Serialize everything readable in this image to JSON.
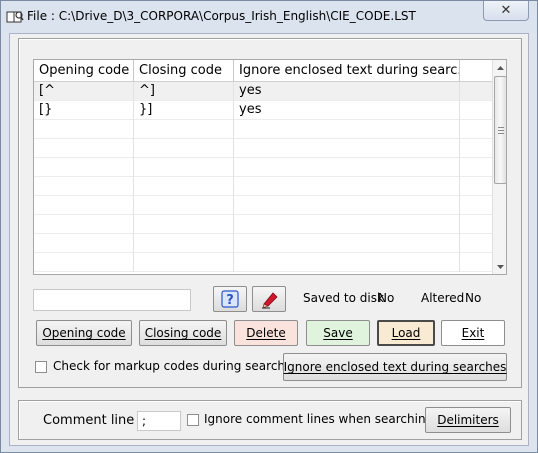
{
  "window": {
    "title": "File :  C:\\Drive_D\\3_CORPORA\\Corpus_Irish_English\\CIE_CODE.LST",
    "close_label": "✕"
  },
  "table": {
    "headers": [
      "Opening code",
      "Closing code",
      "Ignore enclosed text during searc..."
    ],
    "rows": [
      [
        "[^",
        "^]",
        "yes"
      ],
      [
        "[}",
        "}]",
        "yes"
      ]
    ]
  },
  "status": {
    "saved_label": "Saved to disk",
    "saved_value": "No",
    "altered_label": "Altered",
    "altered_value": "No"
  },
  "buttons": {
    "opening_code": "Opening code",
    "closing_code": "Closing code",
    "delete": "Delete",
    "save": "Save",
    "load": "Load",
    "exit": "Exit",
    "ignore_enclosed": "Ignore enclosed text during searches",
    "delimiters": "Delimiters"
  },
  "checks": {
    "markup_codes": "Check for markup codes during searches",
    "ignore_comment": "Ignore comment lines when searching"
  },
  "comment": {
    "label": "Comment line",
    "value": ";"
  },
  "colors": {
    "delete_bg": "#fbe3dd",
    "save_bg": "#e0f3dc",
    "load_bg": "#f8ead3",
    "help_icon": "#2b56c6",
    "pen_icon": "#d0182c"
  }
}
